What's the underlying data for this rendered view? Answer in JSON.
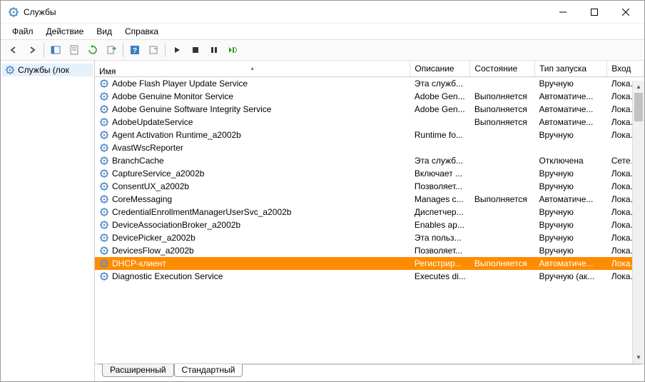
{
  "window": {
    "title": "Службы"
  },
  "menu": {
    "file": "Файл",
    "action": "Действие",
    "view": "Вид",
    "help": "Справка"
  },
  "tree": {
    "root": "Службы (лок"
  },
  "columns": {
    "name": "Имя",
    "description": "Описание",
    "state": "Состояние",
    "startup": "Тип запуска",
    "logon": "Вход"
  },
  "tabs": {
    "extended": "Расширенный",
    "standard": "Стандартный"
  },
  "services": [
    {
      "name": "Adobe Flash Player Update Service",
      "desc": "Эта служб...",
      "state": "",
      "startup": "Вручную",
      "logon": "Лока..."
    },
    {
      "name": "Adobe Genuine Monitor Service",
      "desc": "Adobe Gen...",
      "state": "Выполняется",
      "startup": "Автоматиче...",
      "logon": "Лока..."
    },
    {
      "name": "Adobe Genuine Software Integrity Service",
      "desc": "Adobe Gen...",
      "state": "Выполняется",
      "startup": "Автоматиче...",
      "logon": "Лока..."
    },
    {
      "name": "AdobeUpdateService",
      "desc": "",
      "state": "Выполняется",
      "startup": "Автоматиче...",
      "logon": "Лока..."
    },
    {
      "name": "Agent Activation Runtime_a2002b",
      "desc": "Runtime fo...",
      "state": "",
      "startup": "Вручную",
      "logon": "Лока..."
    },
    {
      "name": "AvastWscReporter",
      "desc": "",
      "state": "",
      "startup": "",
      "logon": ""
    },
    {
      "name": "BranchCache",
      "desc": "Эта служб...",
      "state": "",
      "startup": "Отключена",
      "logon": "Сетев..."
    },
    {
      "name": "CaptureService_a2002b",
      "desc": "Включает ...",
      "state": "",
      "startup": "Вручную",
      "logon": "Лока..."
    },
    {
      "name": "ConsentUX_a2002b",
      "desc": "Позволяет...",
      "state": "",
      "startup": "Вручную",
      "logon": "Лока..."
    },
    {
      "name": "CoreMessaging",
      "desc": "Manages c...",
      "state": "Выполняется",
      "startup": "Автоматиче...",
      "logon": "Лока..."
    },
    {
      "name": "CredentialEnrollmentManagerUserSvc_a2002b",
      "desc": "Диспетчер...",
      "state": "",
      "startup": "Вручную",
      "logon": "Лока..."
    },
    {
      "name": "DeviceAssociationBroker_a2002b",
      "desc": "Enables ap...",
      "state": "",
      "startup": "Вручную",
      "logon": "Лока..."
    },
    {
      "name": "DevicePicker_a2002b",
      "desc": "Эта польз...",
      "state": "",
      "startup": "Вручную",
      "logon": "Лока..."
    },
    {
      "name": "DevicesFlow_a2002b",
      "desc": "Позволяет...",
      "state": "",
      "startup": "Вручную",
      "logon": "Лока..."
    },
    {
      "name": "DHCP-клиент",
      "desc": "Регистрир...",
      "state": "Выполняется",
      "startup": "Автоматиче...",
      "logon": "Лока...",
      "selected": true
    },
    {
      "name": "Diagnostic Execution Service",
      "desc": "Executes di...",
      "state": "",
      "startup": "Вручную (ак...",
      "logon": "Лока..."
    }
  ]
}
